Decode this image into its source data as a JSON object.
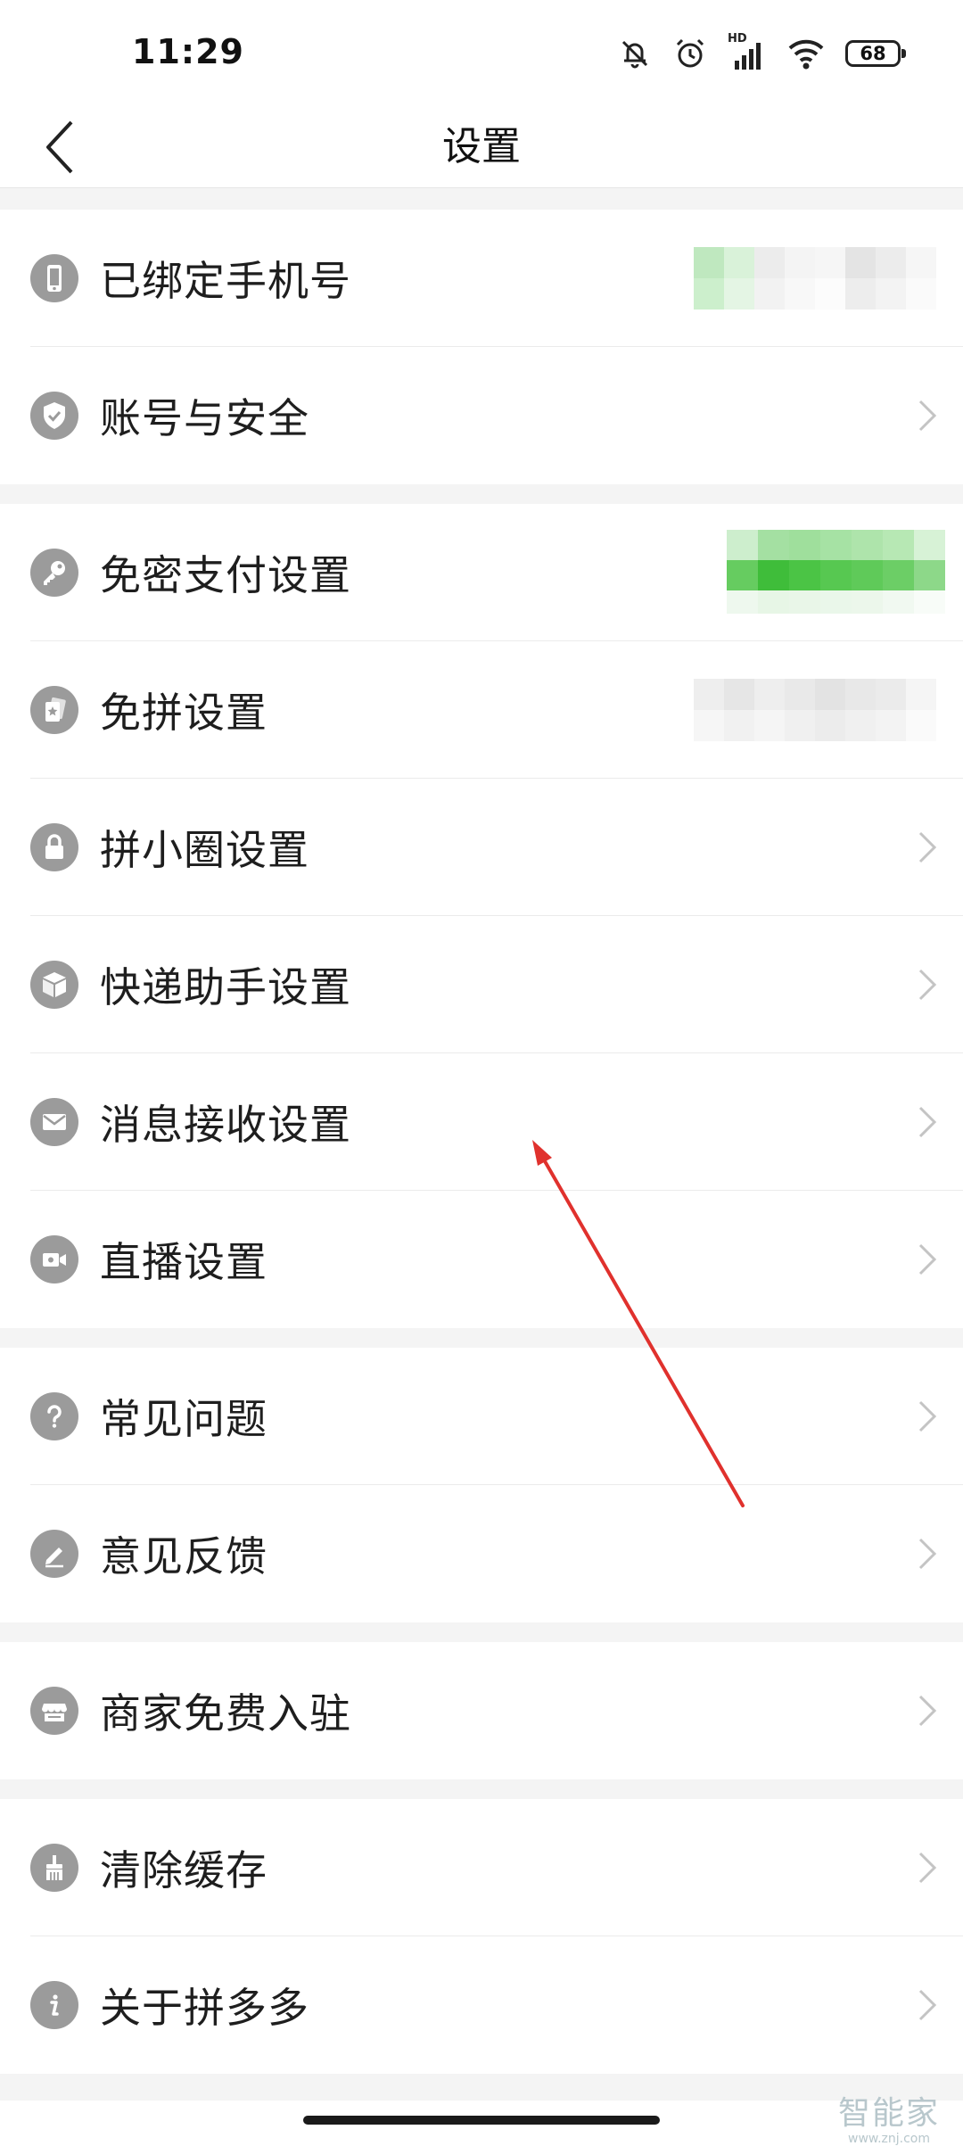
{
  "status_bar": {
    "time": "11:29",
    "network": "HD",
    "battery": "68"
  },
  "header": {
    "title": "设置"
  },
  "settings": {
    "bound_phone": {
      "label": "已绑定手机号",
      "icon": "phone-icon"
    },
    "account_security": {
      "label": "账号与安全",
      "icon": "shield-check-icon"
    },
    "password_free_payment": {
      "label": "免密支付设置",
      "icon": "key-icon"
    },
    "free_group": {
      "label": "免拼设置",
      "icon": "card-star-icon"
    },
    "circle": {
      "label": "拼小圈设置",
      "icon": "lock-icon"
    },
    "delivery_assistant": {
      "label": "快递助手设置",
      "icon": "package-icon"
    },
    "message_receive": {
      "label": "消息接收设置",
      "icon": "mail-icon"
    },
    "live_stream": {
      "label": "直播设置",
      "icon": "video-camera-icon"
    },
    "faq": {
      "label": "常见问题",
      "icon": "question-icon"
    },
    "feedback": {
      "label": "意见反馈",
      "icon": "pencil-icon"
    },
    "merchant_join": {
      "label": "商家免费入驻",
      "icon": "store-icon"
    },
    "clear_cache": {
      "label": "清除缓存",
      "icon": "brush-icon"
    },
    "about": {
      "label": "关于拼多多",
      "icon": "info-icon"
    }
  },
  "watermark": {
    "name": "智能家",
    "url": "www.znj.com"
  },
  "colors": {
    "icon_gray": "#9b9b9b",
    "divider": "#ebebeb",
    "section_gap": "#f4f4f4",
    "annotation_arrow": "#e0312d",
    "blurred_green": "#4cc64a"
  }
}
